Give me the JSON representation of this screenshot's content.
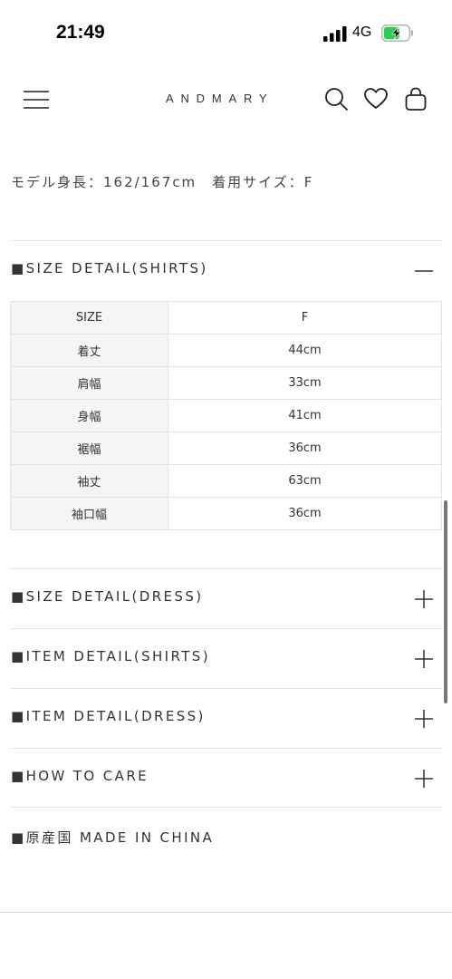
{
  "status_bar": {
    "time": "21:49",
    "network": "4G",
    "icons": [
      "signal-bars-icon",
      "battery-charging-icon"
    ]
  },
  "header": {
    "logo": "ANDMARY",
    "icons": [
      "hamburger-menu-icon",
      "search-icon",
      "heart-icon",
      "shopping-bag-icon"
    ]
  },
  "model_info": "モデル身長：162/167cm　着用サイズ：F",
  "sections": {
    "size_detail_shirts": "■SIZE DETAIL(SHIRTS)",
    "size_detail_dress": "■SIZE DETAIL(DRESS)",
    "item_detail_shirts": "■ITEM DETAIL(SHIRTS)",
    "item_detail_dress": "■ITEM DETAIL(DRESS)",
    "how_to_care": "■HOW TO CARE",
    "origin": "■原産国 MADE IN CHINA"
  },
  "size_table": {
    "header": [
      "SIZE",
      "F"
    ],
    "rows": [
      [
        "着丈",
        "44cm"
      ],
      [
        "肩幅",
        "33cm"
      ],
      [
        "身幅",
        "41cm"
      ],
      [
        "裾幅",
        "36cm"
      ],
      [
        "袖丈",
        "63cm"
      ],
      [
        "袖口幅",
        "36cm"
      ]
    ]
  },
  "toggle_icons": [
    "minus-icon",
    "plus-icon"
  ],
  "colors": {
    "text": "#333333",
    "table_label_bg": "#f5f5f5",
    "divider": "#e4e4e4",
    "battery_fill": "#34c759"
  }
}
